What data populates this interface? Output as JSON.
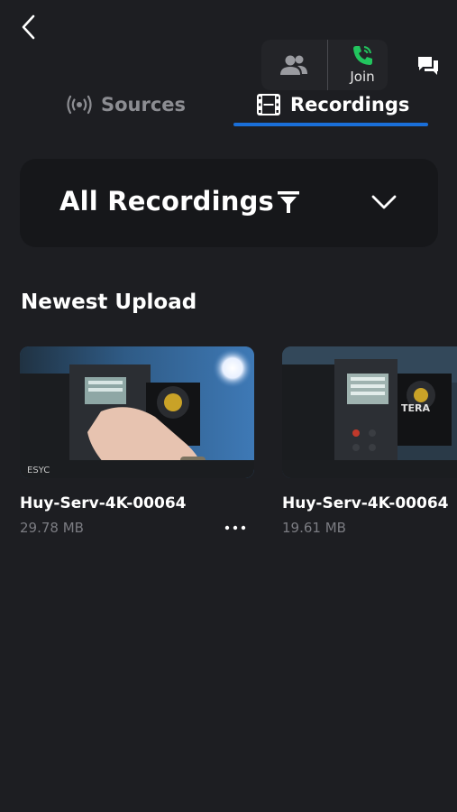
{
  "header": {
    "back_icon": "chevron-left-icon",
    "call": {
      "people_icon": "people-icon",
      "join_icon": "phone-icon",
      "join_label": "Join",
      "join_color": "#22c55e"
    },
    "chat_icon": "chat-icon"
  },
  "tabs": [
    {
      "label": "Sources",
      "icon": "broadcast-icon",
      "active": false
    },
    {
      "label": "Recordings",
      "icon": "film-icon",
      "active": true
    }
  ],
  "accent_color": "#1a6fd9",
  "filter": {
    "label": "All Recordings",
    "filter_icon": "filter-icon",
    "dropdown_icon": "chevron-down-icon"
  },
  "section_title": "Newest Upload",
  "recordings": [
    {
      "name": "Huy-Serv-4K-00064",
      "size": "29.78 MB"
    },
    {
      "name": "Huy-Serv-4K-00064",
      "size": "19.61 MB"
    }
  ]
}
